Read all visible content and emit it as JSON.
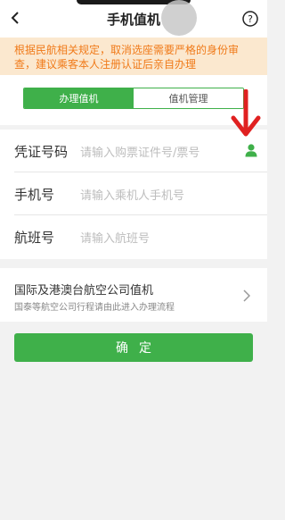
{
  "header": {
    "title": "手机值机"
  },
  "notice": {
    "text": "根据民航相关规定，取消选座需要严格的身份审查，建议乘客本人注册认证后亲自办理"
  },
  "tabs": [
    {
      "label": "办理值机",
      "active": true
    },
    {
      "label": "值机管理",
      "active": false
    }
  ],
  "form": {
    "rows": [
      {
        "label": "凭证号码",
        "placeholder": "请输入购票证件号/票号"
      },
      {
        "label": "手机号",
        "placeholder": "请输入乘机人手机号"
      },
      {
        "label": "航班号",
        "placeholder": "请输入航班号"
      }
    ]
  },
  "international": {
    "title": "国际及港澳台航空公司值机",
    "subtitle": "国泰等航空公司行程请由此进入办理流程"
  },
  "confirm_button": {
    "label": "确定"
  },
  "colors": {
    "accent": "#3fb04a",
    "notice_bg": "#fbe8cf",
    "notice_text": "#f07a19",
    "arrow": "#e02020"
  },
  "icons": [
    "back-icon",
    "help-icon",
    "person-icon",
    "chevron-right-icon",
    "red-down-arrow-annotation"
  ]
}
